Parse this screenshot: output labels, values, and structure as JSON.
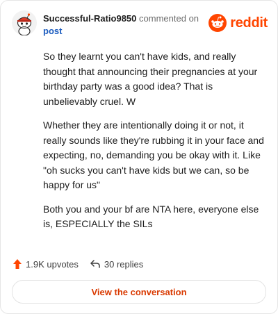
{
  "header": {
    "username": "Successful-Ratio9850",
    "action_text": "commented on",
    "post_link": "post",
    "logo_text": "reddit",
    "avatar_icon": "snoo-avatar-icon",
    "logo_icon": "reddit-alien-icon"
  },
  "comment": {
    "paragraphs": [
      "So they learnt you can't have kids, and really thought that announcing their pregnancies at your birthday party was a good idea? That is unbelievably cruel. W",
      "Whether they are intentionally doing it or not, it really sounds like they're rubbing it in your face and expecting, no, demanding you be okay with it. Like \"oh sucks you can't have kids but we can, so be happy for us\"",
      "Both you and your bf are NTA here, everyone else is, ESPECIALLY the SILs"
    ]
  },
  "footer": {
    "upvotes": "1.9K upvotes",
    "replies": "30 replies",
    "upvote_icon": "upvote-arrow-icon",
    "reply_icon": "reply-arrow-icon"
  },
  "cta": {
    "label": "View the conversation"
  },
  "colors": {
    "brand": "#ff4500",
    "link": "#1c5cbf",
    "cta_text": "#d93900"
  }
}
